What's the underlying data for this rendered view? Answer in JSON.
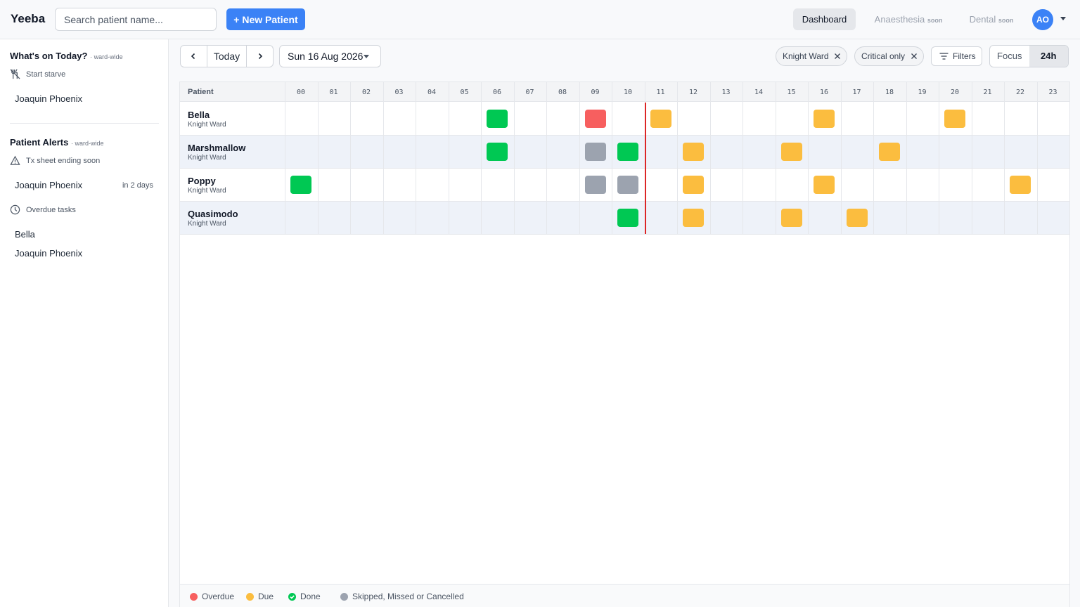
{
  "app": {
    "brand": "Yeeba"
  },
  "header": {
    "search_placeholder": "Search patient name...",
    "new_patient": "+ New Patient",
    "nav": [
      {
        "label": "Dashboard",
        "badge": ""
      },
      {
        "label": "Anaesthesia",
        "badge": "soon"
      },
      {
        "label": "Dental",
        "badge": "soon"
      }
    ],
    "avatar": "AO"
  },
  "sidebar": {
    "today": {
      "title": "What's on Today?",
      "scope": "· ward-wide",
      "section": "Start starve",
      "section_icon": "no-food-icon",
      "items": [
        "Joaquin Phoenix"
      ]
    },
    "alerts": {
      "title": "Patient Alerts",
      "scope": "· ward-wide",
      "sections": [
        {
          "label": "Tx sheet ending soon",
          "icon": "warning-triangle-icon",
          "items": [
            {
              "name": "Joaquin Phoenix",
              "due": "in 2 days"
            }
          ]
        },
        {
          "label": "Overdue tasks",
          "icon": "clock-icon",
          "items": [
            {
              "name": "Bella"
            },
            {
              "name": "Joaquin Phoenix"
            }
          ]
        }
      ]
    }
  },
  "toolbar": {
    "today": "Today",
    "date": "Sun 16 Aug 2026",
    "chips": [
      "Knight Ward",
      "Critical only"
    ],
    "filters": "Filters",
    "views": [
      "Focus",
      "24h"
    ],
    "active_view": "24h"
  },
  "grid": {
    "patient_header": "Patient",
    "hours": [
      "00",
      "01",
      "02",
      "03",
      "04",
      "05",
      "06",
      "07",
      "08",
      "09",
      "10",
      "11",
      "12",
      "13",
      "14",
      "15",
      "16",
      "17",
      "18",
      "19",
      "20",
      "21",
      "22",
      "23"
    ],
    "current_hour": 10,
    "patients": [
      {
        "name": "Bella",
        "ward": "Knight Ward",
        "tasks": [
          {
            "hour": 6,
            "status": "done"
          },
          {
            "hour": 9,
            "status": "overdue"
          },
          {
            "hour": 11,
            "status": "due"
          },
          {
            "hour": 16,
            "status": "due"
          },
          {
            "hour": 20,
            "status": "due"
          }
        ]
      },
      {
        "name": "Marshmallow",
        "ward": "Knight Ward",
        "tasks": [
          {
            "hour": 6,
            "status": "done"
          },
          {
            "hour": 9,
            "status": "skipped"
          },
          {
            "hour": 10,
            "status": "done"
          },
          {
            "hour": 12,
            "status": "due"
          },
          {
            "hour": 15,
            "status": "due"
          },
          {
            "hour": 18,
            "status": "due"
          }
        ]
      },
      {
        "name": "Poppy",
        "ward": "Knight Ward",
        "tasks": [
          {
            "hour": 0,
            "status": "done"
          },
          {
            "hour": 9,
            "status": "skipped"
          },
          {
            "hour": 10,
            "status": "skipped"
          },
          {
            "hour": 12,
            "status": "due"
          },
          {
            "hour": 16,
            "status": "due"
          },
          {
            "hour": 22,
            "status": "due"
          }
        ]
      },
      {
        "name": "Quasimodo",
        "ward": "Knight Ward",
        "tasks": [
          {
            "hour": 10,
            "status": "done"
          },
          {
            "hour": 12,
            "status": "due"
          },
          {
            "hour": 15,
            "status": "due"
          },
          {
            "hour": 17,
            "status": "due"
          }
        ]
      }
    ]
  },
  "legend": [
    {
      "label": "Overdue",
      "status": "overdue"
    },
    {
      "label": "Due",
      "status": "due"
    },
    {
      "label": "Done",
      "status": "done"
    },
    {
      "label": "Skipped, Missed or Cancelled",
      "status": "skipped"
    }
  ],
  "colors": {
    "overdue": "#f75f5f",
    "due": "#fbbd3f",
    "done": "#00c853",
    "skipped": "#9ca3af",
    "accent": "#3b82f6",
    "now_line": "#dc2626"
  }
}
